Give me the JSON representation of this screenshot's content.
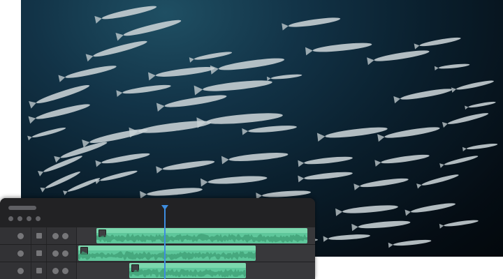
{
  "photo": {
    "subject": "barracuda-school-underwater",
    "colors": {
      "water_light": "#1f4f63",
      "water_dark": "#03080c",
      "fish": "#c9d3d6"
    }
  },
  "timeline": {
    "colors": {
      "panel": "#2a2a2c",
      "clip": "#5ec79b",
      "clip_highlight": "#7bd8ae",
      "playhead": "#3d8de0"
    },
    "tracks": [
      {
        "name": "track-1",
        "clip": "audio-clip-1"
      },
      {
        "name": "track-2",
        "clip": "audio-clip-2"
      },
      {
        "name": "track-3",
        "clip": "audio-clip-3"
      }
    ],
    "icons": [
      "track-toggle-icon",
      "track-lock-icon",
      "track-mute-icon",
      "track-solo-icon"
    ]
  }
}
